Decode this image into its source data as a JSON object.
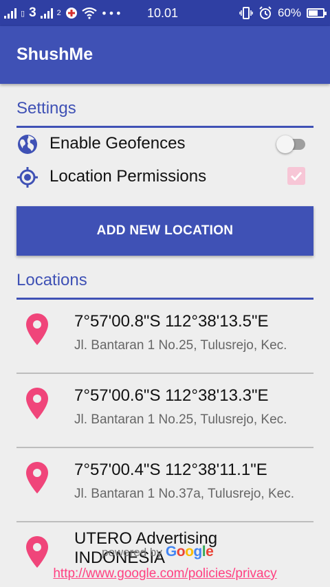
{
  "status_bar": {
    "carrier_sim2_label": "2",
    "time": "10.01",
    "battery": "60%",
    "more_dots": "•••",
    "carrier_logo": "3"
  },
  "app_bar": {
    "title": "ShushMe"
  },
  "settings": {
    "header": "Settings",
    "geofences": {
      "label": "Enable Geofences",
      "icon": "globe-icon",
      "enabled": false
    },
    "permissions": {
      "label": "Location Permissions",
      "icon": "gps-target-icon",
      "checked": true
    }
  },
  "add_button": {
    "label": "ADD NEW LOCATION"
  },
  "locations": {
    "header": "Locations",
    "items": [
      {
        "title": "7°57'00.8\"S 112°38'13.5\"E",
        "address": "Jl. Bantaran 1 No.25, Tulusrejo, Kec."
      },
      {
        "title": "7°57'00.6\"S 112°38'13.3\"E",
        "address": "Jl. Bantaran 1 No.25, Tulusrejo, Kec."
      },
      {
        "title": "7°57'00.4\"S 112°38'11.1\"E",
        "address": "Jl. Bantaran 1 No.37a, Tulusrejo, Kec."
      },
      {
        "title": "UTERO Advertising INDONESIA",
        "address": ""
      }
    ]
  },
  "attribution": {
    "powered_by": "powered by",
    "google": [
      "G",
      "o",
      "o",
      "g",
      "l",
      "e"
    ],
    "privacy_link": "http://www.google.com/policies/privacy"
  },
  "colors": {
    "primary": "#3f51b5",
    "status_bar": "#2f3fa3",
    "accent": "#ff4081",
    "pin": "#f0457a"
  }
}
